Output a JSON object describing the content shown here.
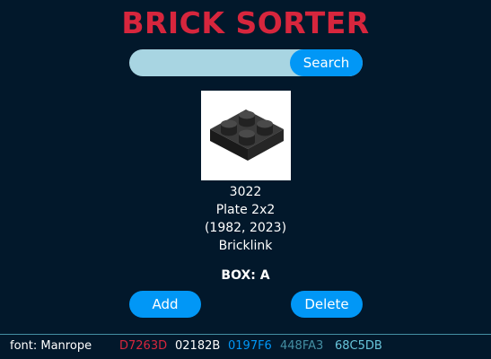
{
  "app": {
    "title": "BRICK SORTER"
  },
  "search": {
    "value": "",
    "placeholder": "",
    "button_label": "Search"
  },
  "part": {
    "image_icon": "lego-plate-2x2-icon",
    "number": "3022",
    "name": "Plate 2x2",
    "years": "(1982, 2023)",
    "source": "Bricklink",
    "box": "BOX: A"
  },
  "actions": {
    "add_label": "Add",
    "delete_label": "Delete"
  },
  "footer": {
    "font_label": "font: Manrope",
    "palette": [
      {
        "label": "D7263D",
        "color": "#D7263D"
      },
      {
        "label": "02182B",
        "color": "#02182B"
      },
      {
        "label": "0197F6",
        "color": "#0197F6"
      },
      {
        "label": "448FA3",
        "color": "#448FA3"
      },
      {
        "label": "68C5DB",
        "color": "#68C5DB"
      }
    ]
  }
}
